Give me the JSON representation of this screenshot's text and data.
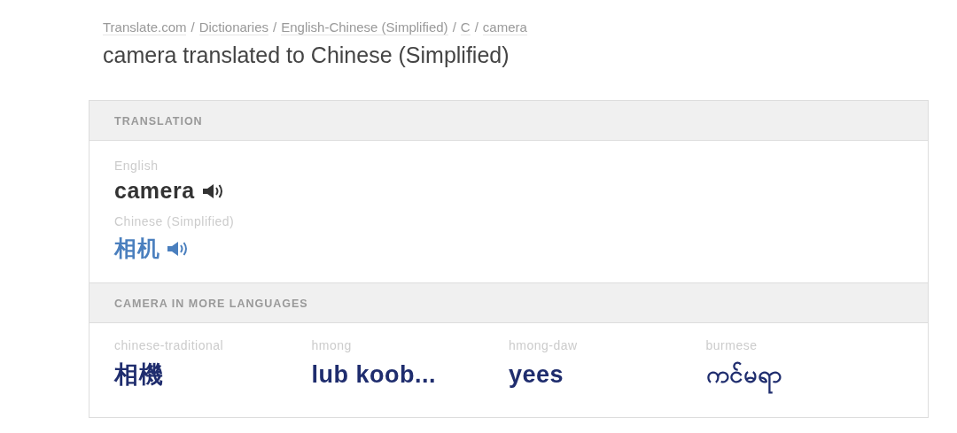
{
  "breadcrumbs": [
    "Translate.com",
    "Dictionaries",
    "English-Chinese (Simplified)",
    "C",
    "camera"
  ],
  "breadcrumb_separator": "/",
  "title": "camera translated to Chinese (Simplified)",
  "translation": {
    "heading": "TRANSLATION",
    "entries": [
      {
        "language": "English",
        "text": "camera",
        "kind": "source"
      },
      {
        "language": "Chinese (Simplified)",
        "text": "相机",
        "kind": "target"
      }
    ]
  },
  "more_languages": {
    "heading": "CAMERA IN MORE LANGUAGES",
    "items": [
      {
        "language": "chinese-traditional",
        "text": "相機"
      },
      {
        "language": "hmong",
        "text": "lub koob..."
      },
      {
        "language": "hmong-daw",
        "text": "yees"
      },
      {
        "language": "burmese",
        "text": "ကင်မရာ"
      }
    ]
  }
}
